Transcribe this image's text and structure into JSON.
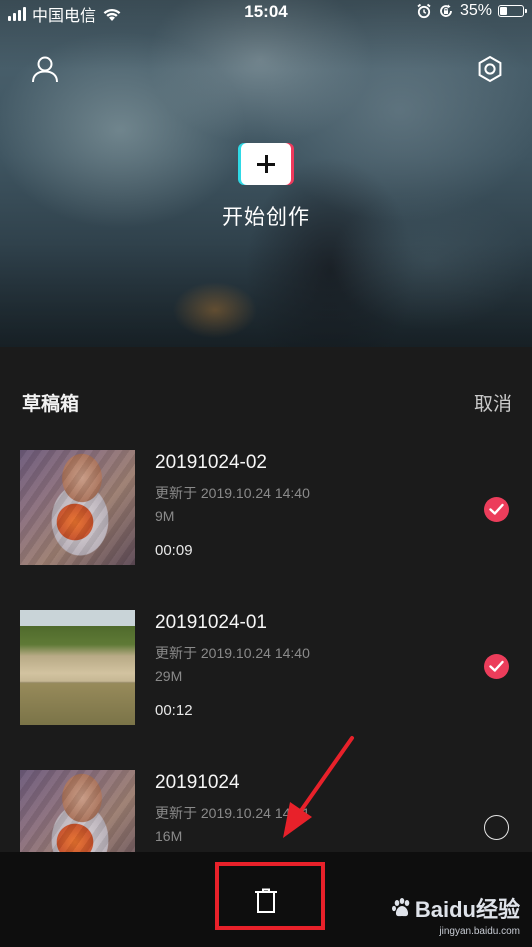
{
  "status_bar": {
    "carrier": "中国电信",
    "time": "15:04",
    "battery_text": "35%",
    "battery_level": 0.35
  },
  "header": {
    "profile_icon": "person-icon",
    "settings_icon": "gear-icon",
    "create_label": "开始创作"
  },
  "drafts": {
    "title": "草稿箱",
    "cancel_label": "取消",
    "items": [
      {
        "title": "20191024-02",
        "updated": "更新于 2019.10.24 14:40",
        "size": "9M",
        "duration": "00:09",
        "selected": true
      },
      {
        "title": "20191024-01",
        "updated": "更新于 2019.10.24 14:40",
        "size": "29M",
        "duration": "00:12",
        "selected": true
      },
      {
        "title": "20191024",
        "updated": "更新于 2019.10.24 14:31",
        "size": "16M",
        "duration": "",
        "selected": false
      }
    ]
  },
  "bottom_bar": {
    "delete_icon": "trash-icon"
  },
  "watermark": {
    "brand": "Baidu经验",
    "url": "jingyan.baidu.com"
  },
  "colors": {
    "accent": "#ec3d5b",
    "highlight_box": "#e8212a",
    "panel_bg": "#1b1b1b",
    "bottom_bg": "#0e0e0e"
  }
}
